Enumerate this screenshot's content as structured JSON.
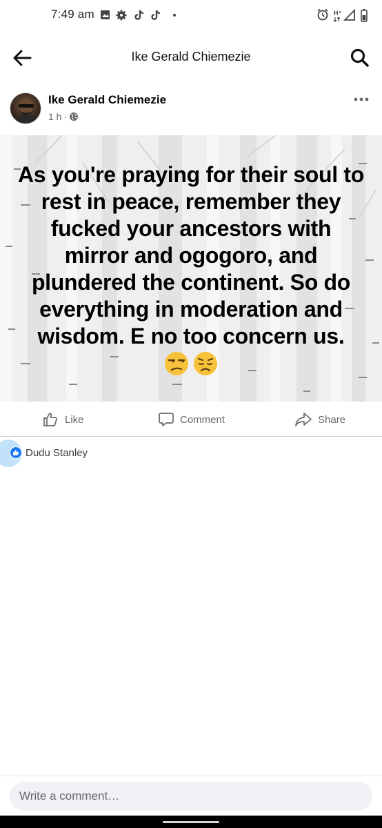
{
  "status_bar": {
    "time": "7:49 am",
    "left_icons": [
      "gallery-icon",
      "gear-icon",
      "tiktok-icon",
      "tiktok-icon",
      "dot-icon"
    ],
    "right_icons": [
      "alarm-icon",
      "hplus-icon",
      "signal-icon",
      "battery-icon"
    ]
  },
  "header": {
    "title": "Ike Gerald Chiemezie",
    "back_icon": "arrow-left-icon",
    "search_icon": "search-icon"
  },
  "post": {
    "author": "Ike Gerald Chiemezie",
    "time_ago": "1 h",
    "separator": "·",
    "privacy_icon": "globe-icon",
    "more_icon": "more-dots-icon",
    "text": "As you're praying for their soul to rest in peace, remember they fucked your ancestors with mirror and ogogoro, and plundered the continent. So do everything in moderation and wisdom. E no too concern us.",
    "emojis": [
      "unamused-face-emoji",
      "disappointed-face-emoji"
    ],
    "background_color": "#efefef"
  },
  "actions": {
    "like": "Like",
    "comment": "Comment",
    "share": "Share"
  },
  "reactions": {
    "reactor_name": "Dudu Stanley",
    "reaction_icon": "like-reaction-icon",
    "accent": "#1877f2"
  },
  "comment_box": {
    "placeholder": "Write a comment…"
  }
}
